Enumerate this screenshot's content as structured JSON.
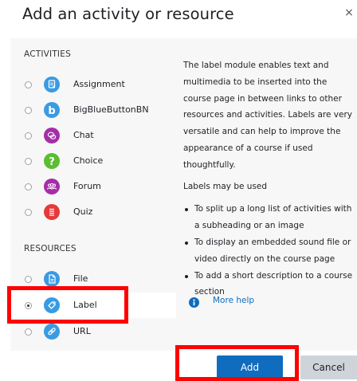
{
  "dialog": {
    "title": "Add an activity or resource",
    "close_glyph": "×"
  },
  "activities": {
    "header": "ACTIVITIES",
    "items": [
      {
        "label": "Assignment",
        "icon": "assignment-icon",
        "color": "#399be2",
        "selected": false
      },
      {
        "label": "BigBlueButtonBN",
        "icon": "bigbluebutton-icon",
        "color": "#399be2",
        "selected": false
      },
      {
        "label": "Chat",
        "icon": "chat-icon",
        "color": "#a52ea8",
        "selected": false
      },
      {
        "label": "Choice",
        "icon": "choice-icon",
        "color": "#5bbd31",
        "selected": false
      },
      {
        "label": "Forum",
        "icon": "forum-icon",
        "color": "#a52ea8",
        "selected": false
      },
      {
        "label": "Quiz",
        "icon": "quiz-icon",
        "color": "#e53a3a",
        "selected": false
      }
    ]
  },
  "resources": {
    "header": "RESOURCES",
    "items": [
      {
        "label": "File",
        "icon": "file-icon",
        "color": "#399be2",
        "selected": false
      },
      {
        "label": "Label",
        "icon": "label-icon",
        "color": "#399be2",
        "selected": true
      },
      {
        "label": "URL",
        "icon": "url-icon",
        "color": "#399be2",
        "selected": false
      }
    ]
  },
  "description": {
    "para1": "The label module enables text and multimedia to be inserted into the course page in between links to other resources and activities. Labels are very versatile and can help to improve the appearance of a course if used thoughtfully.",
    "para2": "Labels may be used",
    "bullets": [
      "To split up a long list of activities with a subheading or an image",
      "To display an embedded sound file or video directly on the course page",
      "To add a short description to a course section"
    ],
    "more_help": "More help"
  },
  "footer": {
    "add_label": "Add",
    "cancel_label": "Cancel"
  },
  "colors": {
    "primary": "#0f6cbf",
    "highlight": "#ff0000",
    "panel_bg": "#f7f7f7"
  }
}
